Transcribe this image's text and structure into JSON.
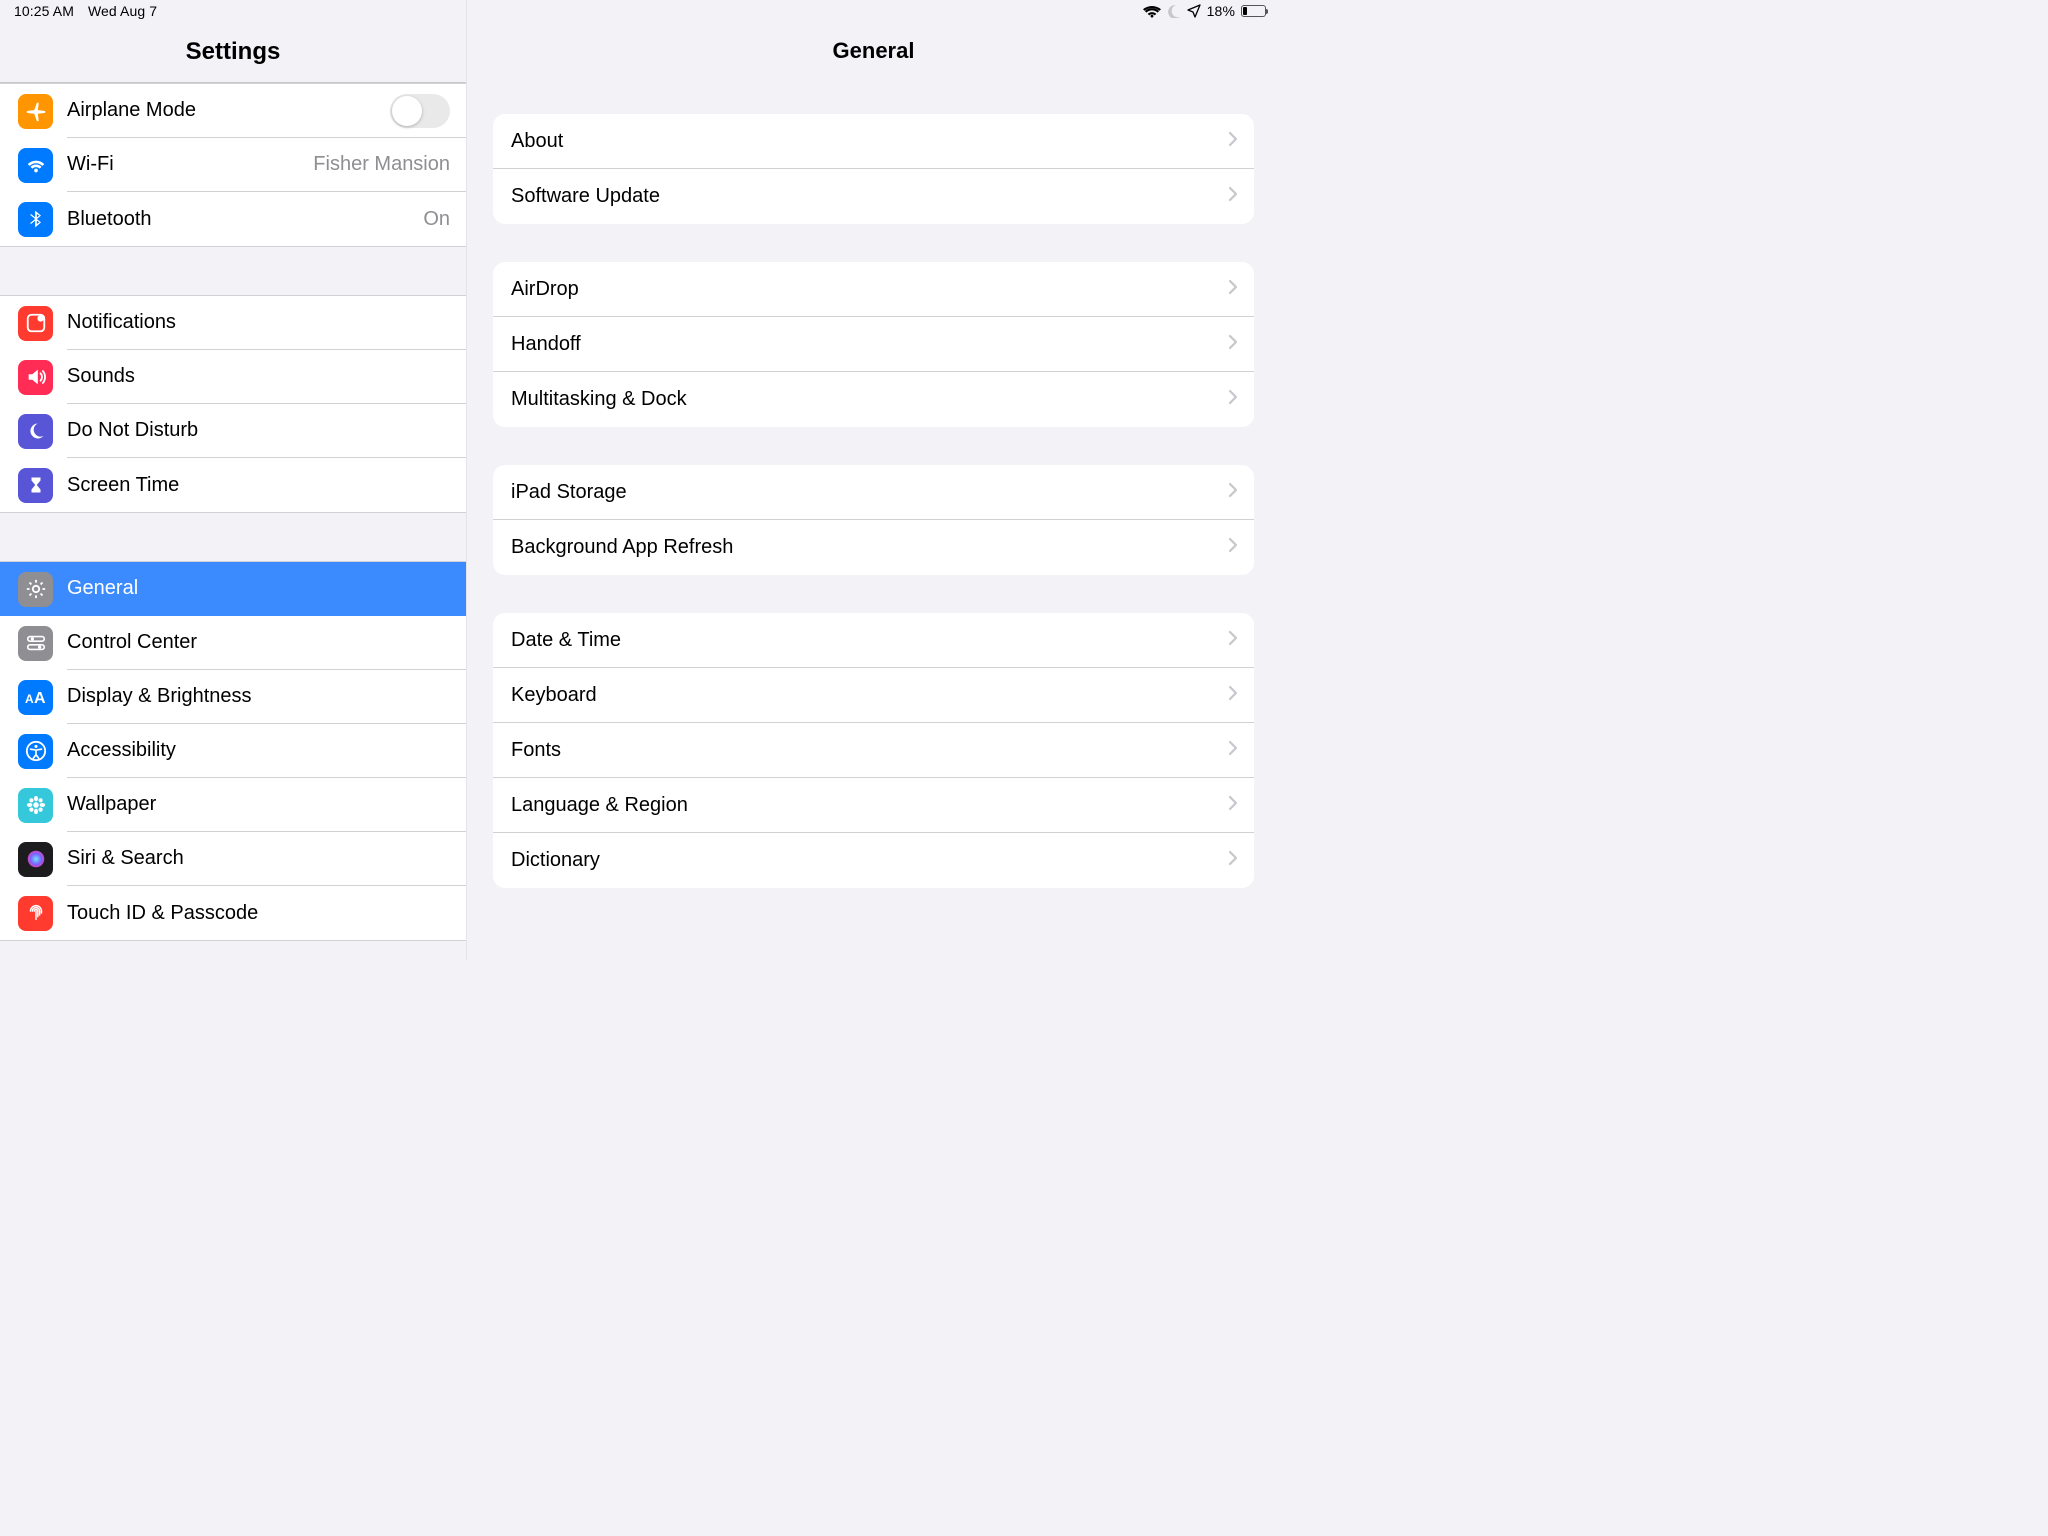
{
  "statusbar": {
    "time": "10:25 AM",
    "date": "Wed Aug 7",
    "battery_pct": "18%"
  },
  "sidebar": {
    "title": "Settings",
    "groups": [
      [
        {
          "id": "airplane",
          "label": "Airplane Mode",
          "type": "toggle",
          "toggle": false,
          "color": "#ff9500",
          "icon": "airplane"
        },
        {
          "id": "wifi",
          "label": "Wi-Fi",
          "value": "Fisher Mansion",
          "color": "#007aff",
          "icon": "wifi"
        },
        {
          "id": "bluetooth",
          "label": "Bluetooth",
          "value": "On",
          "color": "#007aff",
          "icon": "bluetooth"
        }
      ],
      [
        {
          "id": "notifications",
          "label": "Notifications",
          "color": "#ff3b30",
          "icon": "notifications"
        },
        {
          "id": "sounds",
          "label": "Sounds",
          "color": "#ff2d55",
          "icon": "sounds"
        },
        {
          "id": "dnd",
          "label": "Do Not Disturb",
          "color": "#5856d6",
          "icon": "moon"
        },
        {
          "id": "screentime",
          "label": "Screen Time",
          "color": "#5856d6",
          "icon": "hourglass"
        }
      ],
      [
        {
          "id": "general",
          "label": "General",
          "color": "#8e8e93",
          "icon": "gear",
          "selected": true
        },
        {
          "id": "controlcenter",
          "label": "Control Center",
          "color": "#8e8e93",
          "icon": "switches"
        },
        {
          "id": "display",
          "label": "Display & Brightness",
          "color": "#007aff",
          "icon": "aa"
        },
        {
          "id": "accessibility",
          "label": "Accessibility",
          "color": "#007aff",
          "icon": "accessibility"
        },
        {
          "id": "wallpaper",
          "label": "Wallpaper",
          "color": "#35c8db",
          "icon": "flower"
        },
        {
          "id": "siri",
          "label": "Siri & Search",
          "color": "#1c1c1e",
          "icon": "siri"
        },
        {
          "id": "touchid",
          "label": "Touch ID & Passcode",
          "color": "#ff3b30",
          "icon": "fingerprint"
        }
      ]
    ]
  },
  "detail": {
    "title": "General",
    "groups": [
      [
        {
          "id": "about",
          "label": "About"
        },
        {
          "id": "software-update",
          "label": "Software Update"
        }
      ],
      [
        {
          "id": "airdrop",
          "label": "AirDrop"
        },
        {
          "id": "handoff",
          "label": "Handoff"
        },
        {
          "id": "multitasking",
          "label": "Multitasking & Dock"
        }
      ],
      [
        {
          "id": "storage",
          "label": "iPad Storage"
        },
        {
          "id": "bgrefresh",
          "label": "Background App Refresh"
        }
      ],
      [
        {
          "id": "datetime",
          "label": "Date & Time"
        },
        {
          "id": "keyboard",
          "label": "Keyboard"
        },
        {
          "id": "fonts",
          "label": "Fonts"
        },
        {
          "id": "langregion",
          "label": "Language & Region"
        },
        {
          "id": "dictionary",
          "label": "Dictionary"
        }
      ]
    ]
  }
}
